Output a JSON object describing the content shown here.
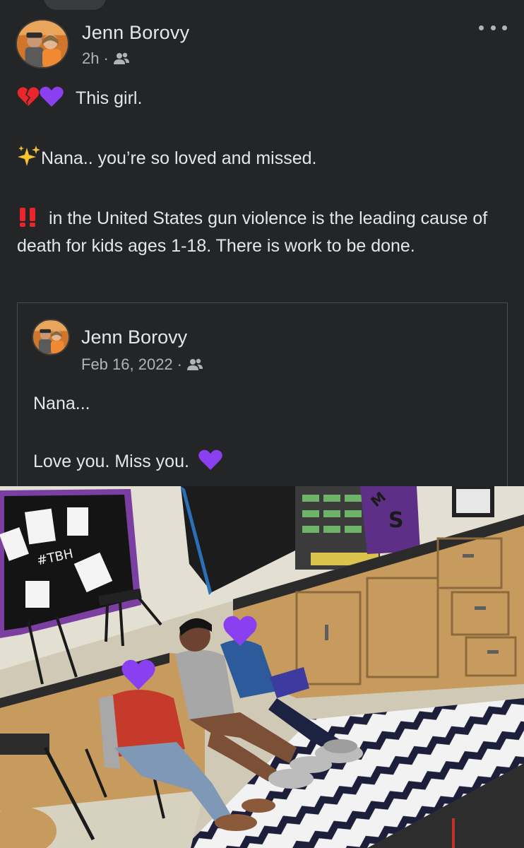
{
  "post": {
    "author": "Jenn Borovy",
    "time": "2h",
    "audience_icon": "friends-icon",
    "more_icon": "more-options-icon",
    "lines": [
      {
        "emoji": [
          "broken-heart",
          "purple-heart"
        ],
        "text": "This girl."
      },
      {
        "emoji": [
          "sparkles"
        ],
        "text": "Nana.. you’re so loved and missed."
      },
      {
        "emoji": [
          "double-exclamation"
        ],
        "text": "in the United States gun violence is the leading cause of death for kids ages 1-18. There is work to be done."
      }
    ]
  },
  "shared": {
    "author": "Jenn Borovy",
    "date": "Feb 16, 2022",
    "audience_icon": "friends-icon",
    "line1": "Nana...",
    "line2": "Love you. Miss you.",
    "line2_emoji": "purple-heart"
  },
  "photo": {
    "board_text": "#TBH",
    "sign_text": "S",
    "sign_text_top": "M",
    "subject": "three students sitting in a classroom, faces covered with purple heart emojis"
  },
  "colors": {
    "background": "#242526",
    "text": "#e4e6eb",
    "secondary_text": "#b0b3b8",
    "purple": "#8a3ff0",
    "red": "#e8262b"
  }
}
